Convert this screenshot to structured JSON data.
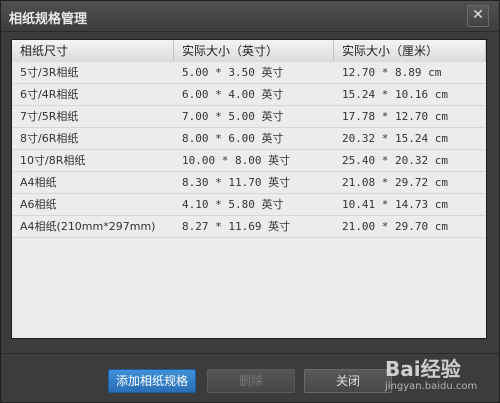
{
  "window": {
    "title": "相纸规格管理",
    "close_glyph": "✕"
  },
  "table": {
    "headers": [
      "相纸尺寸",
      "实际大小（英寸）",
      "实际大小（厘米）"
    ],
    "rows": [
      [
        "5寸/3R相纸",
        "5.00 * 3.50 英寸",
        "12.70 * 8.89 cm"
      ],
      [
        "6寸/4R相纸",
        "6.00 * 4.00 英寸",
        "15.24 * 10.16 cm"
      ],
      [
        "7寸/5R相纸",
        "7.00 * 5.00 英寸",
        "17.78 * 12.70 cm"
      ],
      [
        "8寸/6R相纸",
        "8.00 * 6.00 英寸",
        "20.32 * 15.24 cm"
      ],
      [
        "10寸/8R相纸",
        "10.00 * 8.00 英寸",
        "25.40 * 20.32 cm"
      ],
      [
        "A4相纸",
        "8.30 * 11.70 英寸",
        "21.08 * 29.72 cm"
      ],
      [
        "A6相纸",
        "4.10 * 5.80 英寸",
        "10.41 * 14.73 cm"
      ],
      [
        "A4相纸(210mm*297mm)",
        "8.27 * 11.69 英寸",
        "21.00 * 29.70 cm"
      ]
    ]
  },
  "buttons": {
    "add": "添加相纸规格",
    "delete": "删除",
    "close": "关闭"
  },
  "watermark": {
    "logo": "Bai经验",
    "url": "jingyan.baidu.com"
  }
}
